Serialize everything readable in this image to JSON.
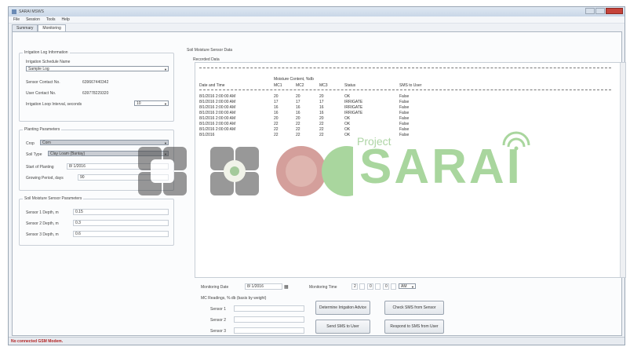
{
  "window": {
    "title": "SARAI MSWS"
  },
  "menu": [
    "File",
    "Session",
    "Tools",
    "Help"
  ],
  "tabs": [
    "Summary",
    "Monitoring"
  ],
  "irrigation_log": {
    "title": "Irrigation Log Information",
    "schedule_name_label": "Irrigation Schedule Name",
    "schedule_name_value": "Sample Log",
    "sensor_contact_label": "Sensor Contact No.",
    "sensor_contact_value": "639667440342",
    "user_contact_label": "User Contact No.",
    "user_contact_value": "639778229320",
    "interval_label": "Irrigation Loop Interval, seconds",
    "interval_value": "10"
  },
  "planting": {
    "title": "Planting Parameters",
    "crop_label": "Crop",
    "crop_value": "Corn",
    "soil_label": "Soil Type",
    "soil_value": "Clay Loam (Bantay)",
    "start_label": "Start of Planting",
    "start_value": "8/ 1/2016",
    "growing_label": "Growing Period, days",
    "growing_value": "90"
  },
  "sensor_params": {
    "title": "Soil Moisture Sensor Parameters",
    "sensors": [
      {
        "label": "Sensor 1 Depth, m",
        "value": "0.15"
      },
      {
        "label": "Sensor 2 Depth, m",
        "value": "0.3"
      },
      {
        "label": "Sensor 3 Depth, m",
        "value": "0.6"
      }
    ]
  },
  "soil_data": {
    "title": "Soil Moisture Sensor Data",
    "recorded_label": "Recorded Data",
    "group_header": "Moisture Content, %db",
    "columns": [
      "Date and Time",
      "MC1",
      "MC2",
      "MC3",
      "Status",
      "SMS to User"
    ],
    "rows": [
      [
        "8/1/2016 2:00:00 AM",
        "20",
        "20",
        "20",
        "OK",
        "False"
      ],
      [
        "8/1/2016 2:00:00 AM",
        "17",
        "17",
        "17",
        "IRRIGATE",
        "False"
      ],
      [
        "8/1/2016 2:00:00 AM",
        "16",
        "16",
        "16",
        "IRRIGATE",
        "False"
      ],
      [
        "8/1/2016 2:00:00 AM",
        "16",
        "16",
        "16",
        "IRRIGATE",
        "False"
      ],
      [
        "8/1/2016 2:00:00 AM",
        "20",
        "20",
        "20",
        "OK",
        "False"
      ],
      [
        "8/1/2016 2:00:00 AM",
        "22",
        "22",
        "22",
        "OK",
        "False"
      ],
      [
        "8/1/2016 2:00:00 AM",
        "22",
        "22",
        "22",
        "OK",
        "False"
      ],
      [
        "8/1/2016",
        "22",
        "22",
        "22",
        "OK",
        "False"
      ]
    ]
  },
  "monitoring": {
    "date_label": "Monitoring Date",
    "date_value": "8/ 1/2016",
    "time_label": "Monitoring Time",
    "time_h": "2",
    "time_m": "0",
    "time_s": "0",
    "time_ampm": "AM",
    "mc_label": "MC Readings, % db (basis by weight)",
    "sensor_labels": [
      "Sensor 1",
      "Sensor 2",
      "Sensor 3"
    ],
    "btn_determine": "Determine Irrigation Advice",
    "btn_check_sms": "Check SMS from Sensor",
    "btn_send_sms": "Send SMS to User",
    "btn_respond": "Respond to SMS from User"
  },
  "status": {
    "text": "No connected GSM Modem."
  },
  "watermark": {
    "small": "Project",
    "big": "SARAI"
  },
  "colors": {
    "accent": "#63b64f",
    "status_error": "#b22222"
  }
}
